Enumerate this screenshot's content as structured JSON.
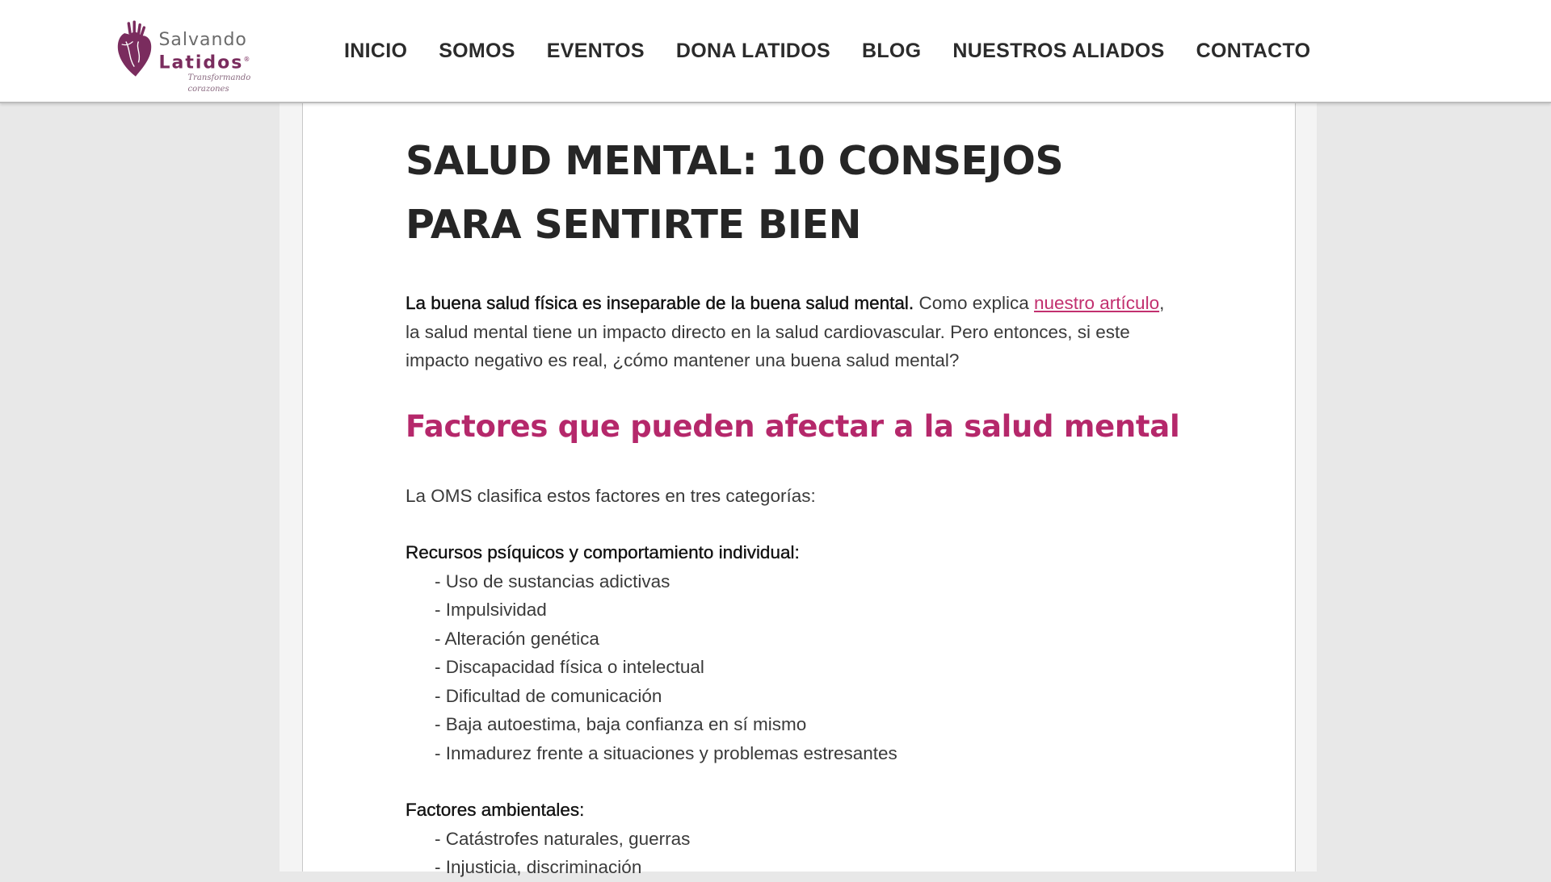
{
  "brand": {
    "line1": "Salvando",
    "line2": "Latidos",
    "registered": "®",
    "tagline": "Transformando corazones",
    "color": "#7a2c5e"
  },
  "nav": {
    "items": [
      {
        "label": "INICIO"
      },
      {
        "label": "SOMOS"
      },
      {
        "label": "EVENTOS"
      },
      {
        "label": "DONA LATIDOS"
      },
      {
        "label": "BLOG"
      },
      {
        "label": "NUESTROS ALIADOS"
      },
      {
        "label": "CONTACTO"
      }
    ]
  },
  "article": {
    "title": "SALUD MENTAL: 10 CONSEJOS PARA SENTIRTE BIEN",
    "intro": {
      "bold": "La buena salud física es inseparable de la buena salud mental.",
      "text_before_link": " Como explica ",
      "link": "nuestro artículo",
      "text_after_link": ", la salud mental tiene un impacto directo en la salud cardiovascular. Pero entonces, si este impacto negativo es real, ¿cómo mantener una buena salud mental?"
    },
    "section_heading": "Factores que pueden afectar a la salud mental",
    "section_intro": "La OMS clasifica estos factores en tres categorías:",
    "group1": {
      "title": "Recursos psíquicos y comportamiento individual:",
      "items": [
        "- Uso de sustancias adictivas",
        "- Impulsividad",
        "- Alteración genética",
        "- Discapacidad física o intelectual",
        "- Dificultad de comunicación",
        "- Baja autoestima, baja confianza en sí mismo",
        "- Inmadurez frente a situaciones y problemas estresantes"
      ]
    },
    "group2": {
      "title": "Factores ambientales:",
      "items": [
        "- Catástrofes naturales, guerras",
        "- Injusticia, discriminación"
      ]
    }
  },
  "colors": {
    "accent": "#b5286b",
    "link": "#c2306f",
    "background": "#e8e8e8"
  }
}
